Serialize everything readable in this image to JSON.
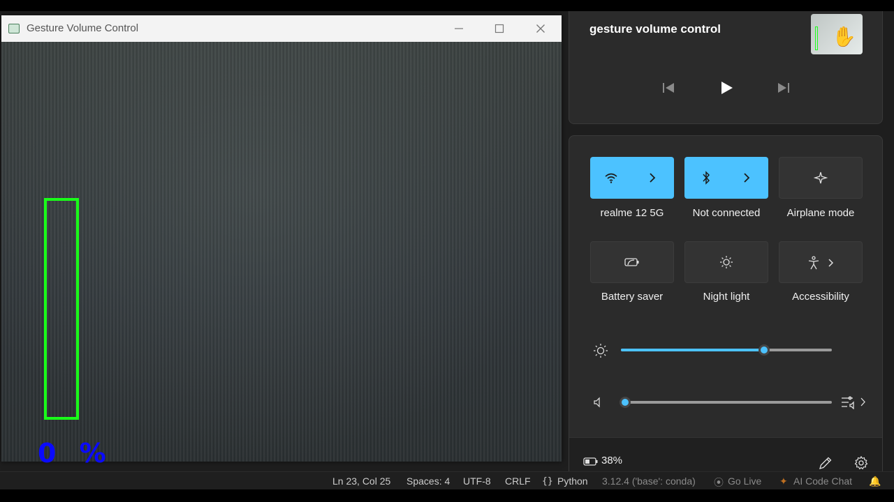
{
  "window": {
    "title": "Gesture Volume Control",
    "volume_percent": 0,
    "volume_text": "0 %"
  },
  "media": {
    "title": "gesture volume control"
  },
  "quick_settings": {
    "tiles": [
      {
        "label": "realme 12 5G",
        "state": "on"
      },
      {
        "label": "Not connected",
        "state": "on"
      },
      {
        "label": "Airplane mode",
        "state": "off"
      },
      {
        "label": "Battery saver",
        "state": "off"
      },
      {
        "label": "Night light",
        "state": "off"
      },
      {
        "label": "Accessibility",
        "state": "off"
      }
    ],
    "brightness_fraction": 0.68,
    "volume_fraction": 0.0,
    "battery_text": "38%"
  },
  "statusbar": {
    "position": "Ln 23, Col 25",
    "spaces": "Spaces: 4",
    "encoding": "UTF-8",
    "eol": "CRLF",
    "language": "Python",
    "interpreter": "3.12.4 ('base': conda)",
    "go_live": "Go Live",
    "ai_chat": "AI Code Chat"
  },
  "colors": {
    "accent": "#4cc2ff",
    "volume_bar": "#19ff19",
    "volume_text": "#0a0aff"
  }
}
